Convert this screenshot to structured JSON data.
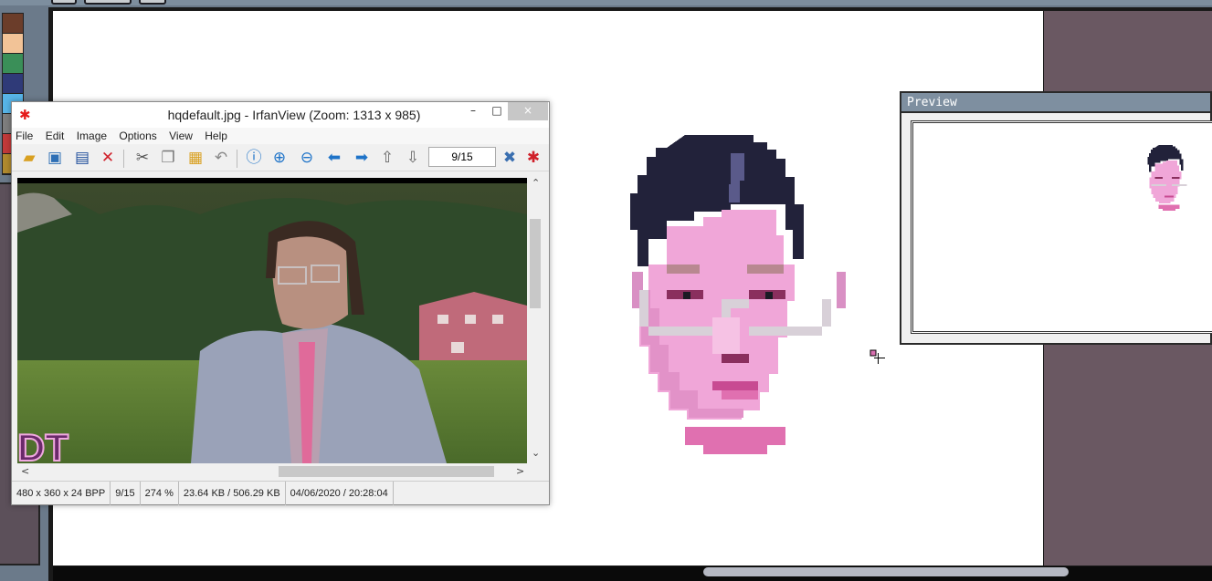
{
  "irfanview": {
    "title": "hqdefault.jpg - IrfanView (Zoom: 1313 x 985)",
    "menu": [
      "File",
      "Edit",
      "Image",
      "Options",
      "View",
      "Help"
    ],
    "page_box": "9/15",
    "status": {
      "dimensions": "480 x 360 x 24 BPP",
      "page": "9/15",
      "zoom": "274 %",
      "size": "23.64 KB / 506.29 KB",
      "datetime": "04/06/2020 / 20:28:04"
    },
    "window_buttons": {
      "minimize": "–",
      "maximize": "□",
      "close": "×"
    }
  },
  "preview": {
    "title": "Preview"
  },
  "palette": {
    "colors": [
      "#6b3d2a",
      "#f2c397",
      "#3a8f58",
      "#2f3a78",
      "#57b4e8",
      "#7e7e7e",
      "#c23a3a",
      "#b08a2e"
    ]
  },
  "icons": {
    "open": "folder-open-icon",
    "thumbnails": "thumbnails-icon",
    "save": "save-icon",
    "delete": "delete-icon",
    "cut": "cut-icon",
    "copy": "copy-icon",
    "paste": "paste-icon",
    "undo": "undo-icon",
    "info": "info-icon",
    "zoom_in": "zoom-in-icon",
    "zoom_out": "zoom-out-icon",
    "prev": "previous-icon",
    "next": "next-icon",
    "first_page": "first-page-icon",
    "last_page": "last-page-icon",
    "settings": "settings-icon",
    "about": "irfanview-logo-icon"
  }
}
